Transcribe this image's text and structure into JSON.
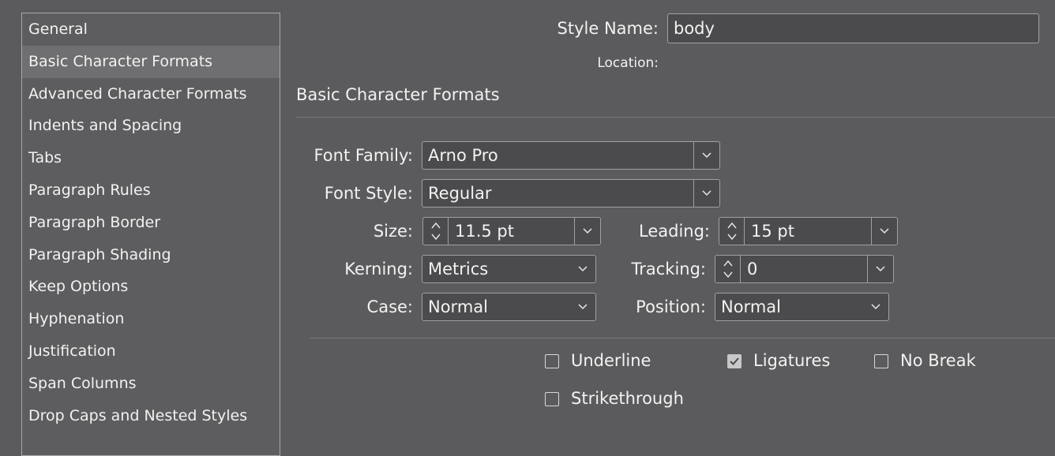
{
  "sidebar": {
    "items": [
      {
        "label": "General"
      },
      {
        "label": "Basic Character Formats",
        "selected": true
      },
      {
        "label": "Advanced Character Formats"
      },
      {
        "label": "Indents and Spacing"
      },
      {
        "label": "Tabs"
      },
      {
        "label": "Paragraph Rules"
      },
      {
        "label": "Paragraph Border"
      },
      {
        "label": "Paragraph Shading"
      },
      {
        "label": "Keep Options"
      },
      {
        "label": "Hyphenation"
      },
      {
        "label": "Justification"
      },
      {
        "label": "Span Columns"
      },
      {
        "label": "Drop Caps and Nested Styles"
      }
    ]
  },
  "header": {
    "style_name_label": "Style Name:",
    "style_name_value": "body",
    "location_label": "Location:"
  },
  "section": {
    "title": "Basic Character Formats"
  },
  "fields": {
    "font_family": {
      "label": "Font Family:",
      "value": "Arno Pro"
    },
    "font_style": {
      "label": "Font Style:",
      "value": "Regular"
    },
    "size": {
      "label": "Size:",
      "value": "11.5 pt"
    },
    "leading": {
      "label": "Leading:",
      "value": "15 pt"
    },
    "kerning": {
      "label": "Kerning:",
      "value": "Metrics"
    },
    "tracking": {
      "label": "Tracking:",
      "value": "0"
    },
    "case": {
      "label": "Case:",
      "value": "Normal"
    },
    "position": {
      "label": "Position:",
      "value": "Normal"
    }
  },
  "checkboxes": {
    "underline": {
      "label": "Underline",
      "checked": false
    },
    "ligatures": {
      "label": "Ligatures",
      "checked": true
    },
    "no_break": {
      "label": "No Break",
      "checked": false
    },
    "strikethrough": {
      "label": "Strikethrough",
      "checked": false
    }
  },
  "icons": {
    "dropdown": "chevron-down-icon",
    "stepper": "stepper-arrows-icon",
    "check": "checkmark-icon"
  },
  "colors": {
    "background": "#5b5b5d",
    "field_bg": "#4b4b4d",
    "selected_item": "#6f6f71"
  }
}
